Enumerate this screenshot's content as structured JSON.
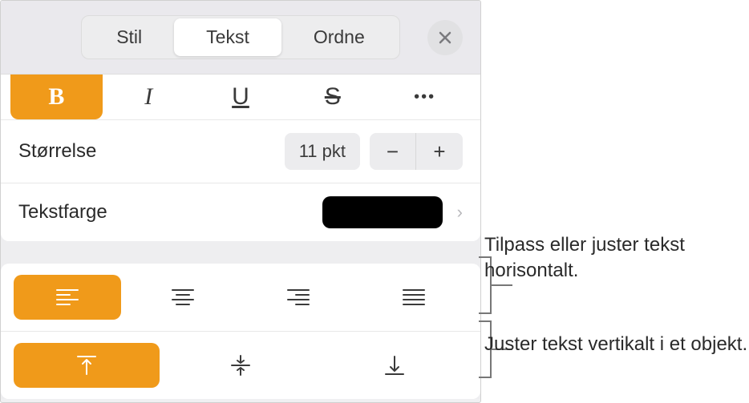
{
  "tabs": {
    "stil": "Stil",
    "tekst": "Tekst",
    "ordne": "Ordne"
  },
  "styleButtons": {
    "bold": "B",
    "italic": "I",
    "underline": "U",
    "strike": "S",
    "more": "•••"
  },
  "size": {
    "label": "Størrelse",
    "value": "11 pkt",
    "minus": "−",
    "plus": "+"
  },
  "textColor": {
    "label": "Tekstfarge",
    "swatch": "#000000",
    "chevron": "›"
  },
  "callouts": {
    "horizontal": "Tilpass eller juster tekst horisontalt.",
    "vertical": "Juster tekst vertikalt i et objekt."
  }
}
